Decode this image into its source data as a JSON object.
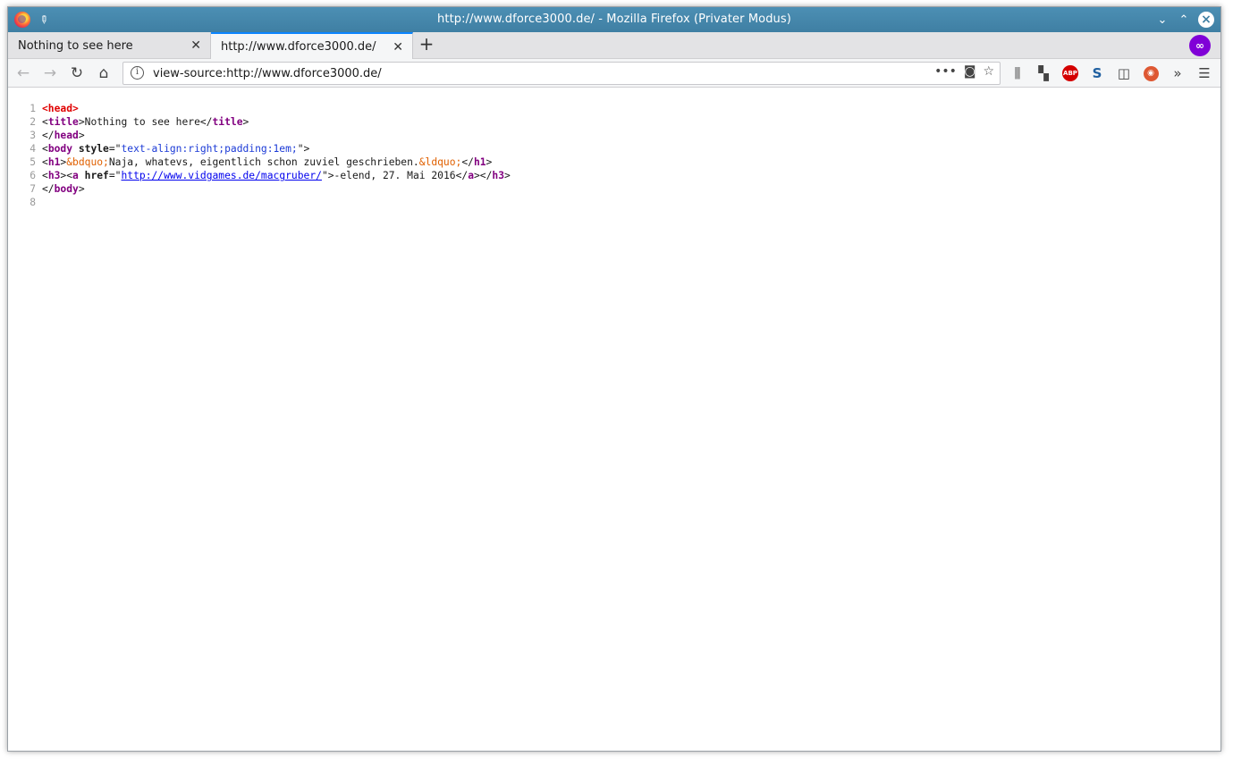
{
  "window": {
    "title": "http://www.dforce3000.de/ - Mozilla Firefox (Privater Modus)"
  },
  "tabs": [
    {
      "label": "Nothing to see here",
      "active": false
    },
    {
      "label": "http://www.dforce3000.de/",
      "active": true
    }
  ],
  "urlbar": {
    "value": "view-source:http://www.dforce3000.de/"
  },
  "source": {
    "line_numbers": [
      "1",
      "2",
      "3",
      "4",
      "5",
      "6",
      "7",
      "8"
    ],
    "line2_text": "Nothing to see here",
    "line4_style_value": "text-align:right;padding:1em;",
    "line5_entity_open": "&bdquo;",
    "line5_text": "Naja, whatevs, eigentlich schon zuviel geschrieben.",
    "line5_entity_close": "&ldquo;",
    "line6_href": "http://www.vidgames.de/macgruber/",
    "line6_text": "-elend, 27. Mai 2016"
  },
  "colors": {
    "titlebar": "#4084aa",
    "tab_accent": "#0a84ff",
    "private_badge": "#8000d7",
    "tag": "#820080",
    "attr_value": "#1b3ad6",
    "entity": "#e06000"
  }
}
